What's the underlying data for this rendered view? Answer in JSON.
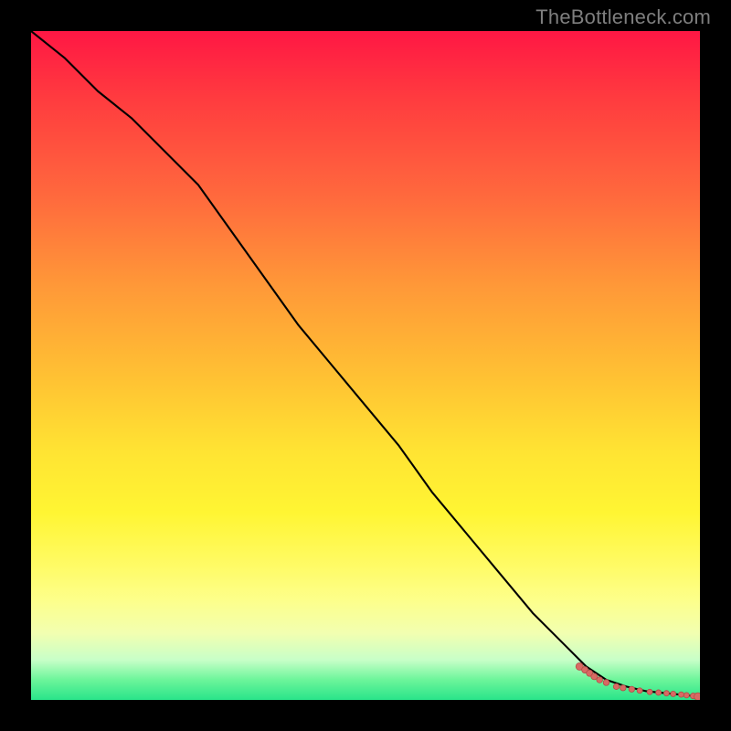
{
  "watermark": "TheBottleneck.com",
  "chart_data": {
    "type": "line",
    "title": "",
    "xlabel": "",
    "ylabel": "",
    "xlim": [
      0,
      100
    ],
    "ylim": [
      0,
      100
    ],
    "grid": false,
    "curve": {
      "name": "bottleneck-curve",
      "x": [
        0,
        5,
        10,
        15,
        20,
        25,
        30,
        35,
        40,
        45,
        50,
        55,
        60,
        65,
        70,
        75,
        80,
        83,
        86,
        89,
        92,
        95,
        97,
        99,
        100
      ],
      "y": [
        100,
        96,
        91,
        87,
        82,
        77,
        70,
        63,
        56,
        50,
        44,
        38,
        31,
        25,
        19,
        13,
        8,
        5,
        3,
        2,
        1.3,
        1.0,
        0.8,
        0.6,
        0.5
      ]
    },
    "points": {
      "name": "sample-dots",
      "x": [
        82.0,
        82.8,
        83.5,
        84.2,
        85.0,
        86.0,
        87.5,
        88.5,
        89.8,
        91.0,
        92.5,
        93.8,
        95.0,
        96.0,
        97.2,
        98.0,
        99.0,
        99.7
      ],
      "y": [
        5.0,
        4.5,
        4.0,
        3.5,
        3.0,
        2.6,
        2.0,
        1.8,
        1.6,
        1.4,
        1.2,
        1.1,
        1.0,
        0.9,
        0.8,
        0.7,
        0.6,
        0.5
      ],
      "r": [
        4.0,
        3.5,
        3.5,
        3.5,
        3.3,
        3.3,
        3.2,
        3.2,
        3.2,
        3.0,
        3.0,
        3.0,
        3.0,
        3.0,
        3.0,
        3.0,
        3.2,
        4.2
      ]
    }
  }
}
